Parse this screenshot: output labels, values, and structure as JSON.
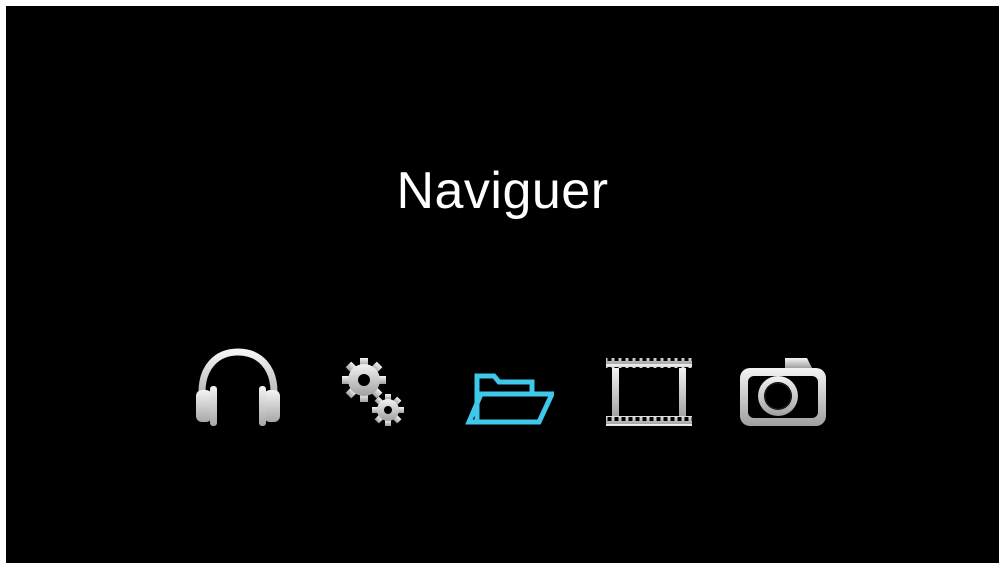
{
  "screen": {
    "title": "Naviguer"
  },
  "colors": {
    "background": "#000000",
    "icon_inactive": "#e6e6e6",
    "icon_selected": "#3ec8ea",
    "title_text": "#ffffff"
  },
  "menu": {
    "selected": "browse",
    "items": [
      {
        "id": "music",
        "icon": "headphones-icon"
      },
      {
        "id": "settings",
        "icon": "gears-icon"
      },
      {
        "id": "browse",
        "icon": "folder-icon"
      },
      {
        "id": "video",
        "icon": "film-strip-icon"
      },
      {
        "id": "photo",
        "icon": "camera-icon"
      }
    ]
  }
}
